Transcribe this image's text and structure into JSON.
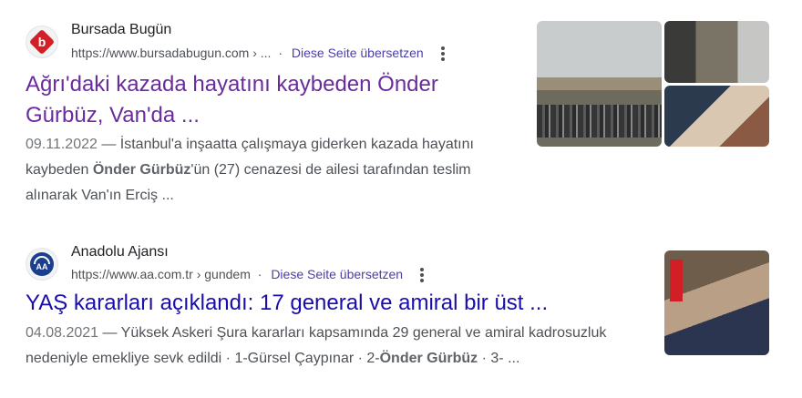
{
  "results": [
    {
      "site_name": "Bursada Bugün",
      "url": "https://www.bursadabugun.com › ...",
      "translate": "Diese Seite übersetzen",
      "favicon_icon": "bursada-bugun-logo",
      "title_line1": "Ağrı'daki kazada hayatını kaybeden Önder",
      "title_line2": "Gürbüz, Van'da ...",
      "date": "09.11.2022",
      "snippet_a": " — İstanbul'a inşaatta çalışmaya giderken kazada hayatını kaybeden ",
      "snippet_bold": "Önder Gürbüz",
      "snippet_b": "'ün (27) cenazesi de ailesi tarafından teslim alınarak Van'ın Erciş ..."
    },
    {
      "site_name": "Anadolu Ajansı",
      "url": "https://www.aa.com.tr › gundem",
      "translate": "Diese Seite übersetzen",
      "favicon_icon": "anadolu-ajansi-logo",
      "favicon_text": "AA",
      "title": "YAŞ kararları açıklandı: 17 general ve amiral bir üst ...",
      "date": "04.08.2021",
      "snippet_a": " — Yüksek Askeri Şura kararları kapsamında 29 general ve amiral kadrosuzluk nedeniyle emekliye sevk edildi · 1-Gürsel Çaypınar · 2-",
      "snippet_bold": "Önder Gürbüz",
      "snippet_b": " · 3- ..."
    }
  ],
  "colors": {
    "visited_title": "#6a2c9c",
    "link_title": "#1a0dab",
    "translate_link": "#4b3fa8"
  }
}
